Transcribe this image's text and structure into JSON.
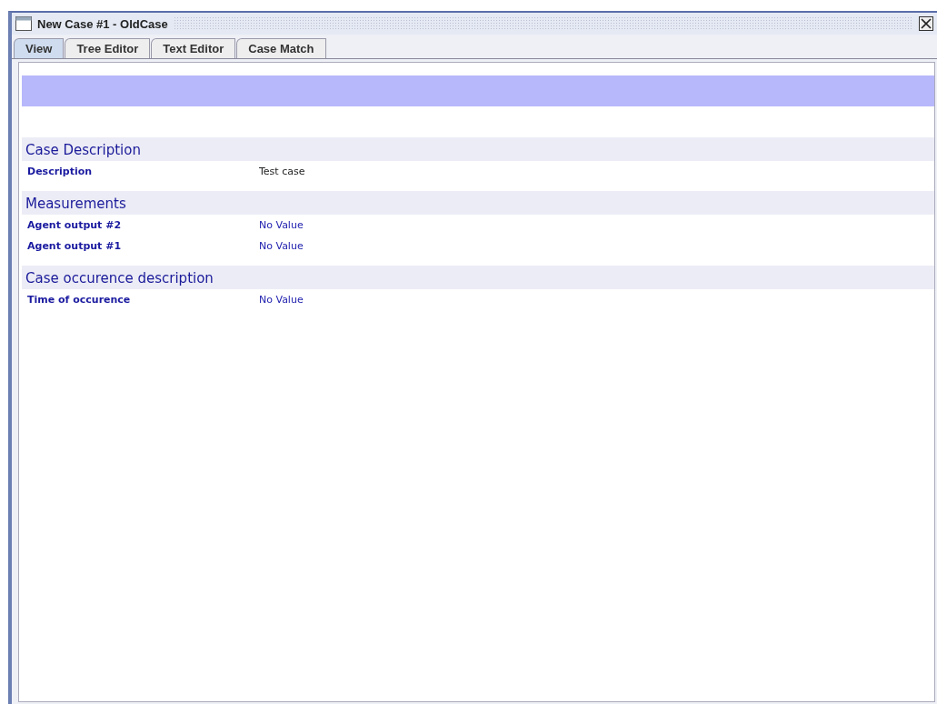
{
  "window": {
    "title": "New Case #1 - OldCase"
  },
  "tabs": [
    {
      "label": "View",
      "selected": true
    },
    {
      "label": "Tree Editor",
      "selected": false
    },
    {
      "label": "Text Editor",
      "selected": false
    },
    {
      "label": "Case Match",
      "selected": false
    }
  ],
  "sections": [
    {
      "title": "Case Description",
      "fields": [
        {
          "label": "Description",
          "value": "Test case",
          "missing": false
        }
      ]
    },
    {
      "title": "Measurements",
      "fields": [
        {
          "label": "Agent output #2",
          "value": "No Value",
          "missing": true
        },
        {
          "label": "Agent output #1",
          "value": "No Value",
          "missing": true
        }
      ]
    },
    {
      "title": "Case occurence description",
      "fields": [
        {
          "label": "Time of occurence",
          "value": "No Value",
          "missing": true
        }
      ]
    }
  ]
}
